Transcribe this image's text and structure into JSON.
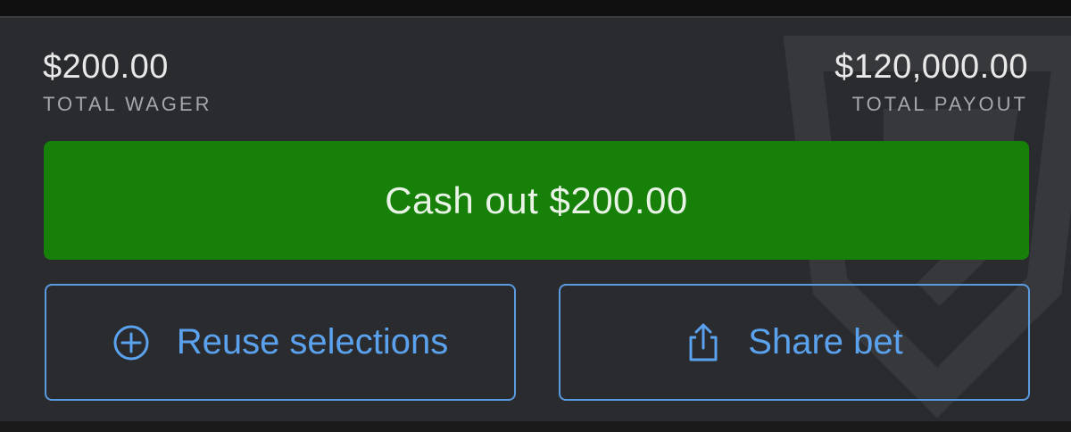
{
  "summary": {
    "wager_amount": "$200.00",
    "wager_label": "TOTAL WAGER",
    "payout_amount": "$120,000.00",
    "payout_label": "TOTAL PAYOUT"
  },
  "actions": {
    "cashout_label": "Cash out $200.00",
    "reuse_label": "Reuse selections",
    "share_label": "Share bet"
  },
  "icons": {
    "reuse": "plus-circle-icon",
    "share": "share-icon",
    "watermark": "brand-shield-logo"
  },
  "colors": {
    "cashout_bg": "#168009",
    "accent_blue": "#5ba2ee",
    "panel_bg": "#2a2b2e"
  }
}
